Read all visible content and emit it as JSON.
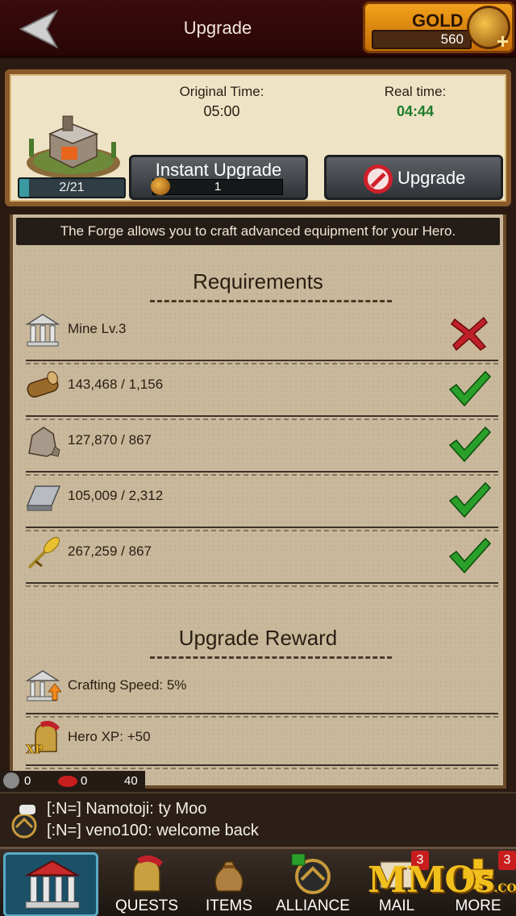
{
  "header": {
    "title": "Upgrade",
    "gold_label": "GOLD",
    "gold_amount": "560"
  },
  "building": {
    "progress_text": "2/21",
    "progress_fraction": 0.095,
    "original_time_label": "Original Time:",
    "original_time_value": "05:00",
    "real_time_label": "Real time:",
    "real_time_value": "04:44",
    "instant_upgrade_label": "Instant Upgrade",
    "instant_upgrade_cost": "1",
    "upgrade_label": "Upgrade"
  },
  "description": "The Forge allows you to craft advanced equipment for your Hero.",
  "requirements": {
    "title": "Requirements",
    "items": [
      {
        "icon": "building-icon",
        "label": "Mine Lv.3",
        "status": "unmet"
      },
      {
        "icon": "wood-icon",
        "label": "143,468 / 1,156",
        "status": "met"
      },
      {
        "icon": "stone-icon",
        "label": "127,870 / 867",
        "status": "met"
      },
      {
        "icon": "iron-icon",
        "label": "105,009 / 2,312",
        "status": "met"
      },
      {
        "icon": "wheat-icon",
        "label": "267,259 / 867",
        "status": "met"
      }
    ]
  },
  "reward": {
    "title": "Upgrade Reward",
    "items": [
      {
        "icon": "crafting-speed-icon",
        "label": "Crafting Speed: 5%"
      },
      {
        "icon": "hero-xp-icon",
        "label": "Hero XP: +50"
      }
    ]
  },
  "mini_stats": {
    "a": "0",
    "b": "0",
    "c": "40"
  },
  "chat": {
    "lines": [
      "[:N=] Namotoji: ty Moo",
      "[:N=] veno100: welcome back"
    ]
  },
  "nav": {
    "quests": "QUESTS",
    "items": "ITEMS",
    "alliance": "ALLIANCE",
    "mail": "MAIL",
    "mail_badge": "3",
    "more": "MORE",
    "more_badge": "3"
  },
  "watermark": {
    "text": "MMOs",
    "sub": ".COM"
  },
  "colors": {
    "accent_gold": "#f2a21a",
    "met": "#2aa02a",
    "unmet": "#c0202a",
    "real_time": "#1d7d2a"
  }
}
